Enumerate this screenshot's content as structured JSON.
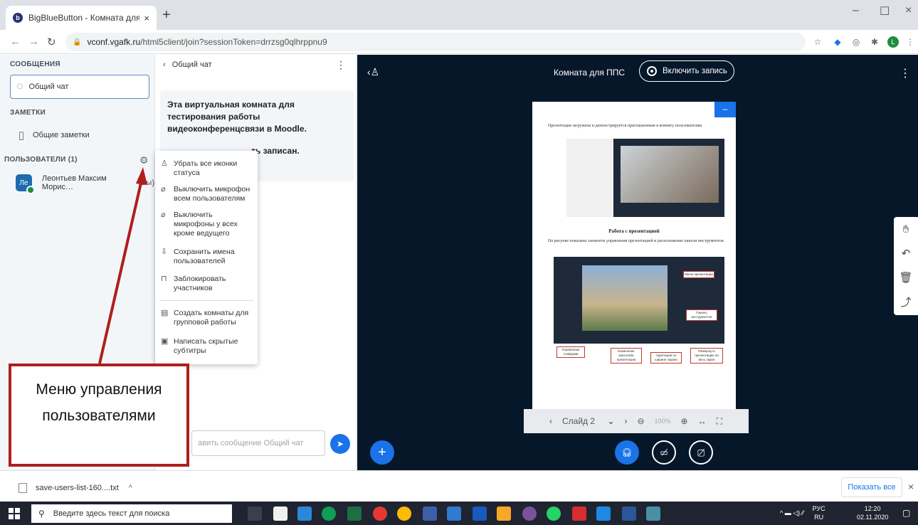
{
  "browser": {
    "tab_title": "BigBlueButton - Комната для П",
    "tab_close": "×",
    "new_tab": "+",
    "url_host": "vconf.vgafk.ru",
    "url_path": "/html5client/join?sessionToken=drrzsg0qlhrppnu9",
    "profile_initial": "L"
  },
  "userlist": {
    "messages_title": "СООБЩЕНИЯ",
    "public_chat": "Общий чат",
    "notes_title": "ЗАМЕТКИ",
    "shared_notes": "Общие заметки",
    "users_title": "ПОЛЬЗОВАТЕЛИ (1)",
    "user_name": "Леонтьев Максим Морис…",
    "user_suffix": "(Вы)",
    "user_initials": "Ле"
  },
  "chat": {
    "header": "Общий чат",
    "welcome_line1": "Эта виртуальная комната для тестирования работы видеоконференцсвязи в Moodle.",
    "welcome_line2": "ть записан.",
    "input_placeholder": "авить сообщение Общий чат"
  },
  "menu": {
    "items": [
      "Убрать все иконки статуса",
      "Выключить микрофон всем пользователям",
      "Выключить микрофоны у всех кроме ведущего",
      "Сохранить имена пользователей",
      "Заблокировать участников",
      "Создать комнаты для групповой работы",
      "Написать скрытые субтитры"
    ]
  },
  "stage": {
    "room_title": "Комната для ППС",
    "record_label": "Включить запись",
    "slide_text1": "Презентация загружена и демонстрируется приглашенным в комнату пользователям.",
    "slide_subtitle": "Работа с презентацией",
    "slide_text2": "На рисунке показаны элементы управления презентацией и расположение панели инструментов.",
    "callouts": [
      "Меню презентации",
      "Панель инструментов",
      "Управление слайдами",
      "Изменение масштаба презентации",
      "Адаптация по ширине экрана",
      "Развернуть презентацию на весь экран"
    ],
    "slide_label": "Слайд 2",
    "zoom_label": "100%"
  },
  "annotation": {
    "text": "Меню управления пользователями"
  },
  "downloads": {
    "file": "save-users-list-160....txt",
    "show_all": "Показать все"
  },
  "taskbar": {
    "search_placeholder": "Введите здесь текст для поиска",
    "lang1": "РУС",
    "lang2": "RU",
    "time": "12:20",
    "date": "02.11.2020"
  },
  "colors": {
    "accent": "#1a73e8",
    "stage_bg": "#06172a",
    "annotation_border": "#b01e1e"
  }
}
